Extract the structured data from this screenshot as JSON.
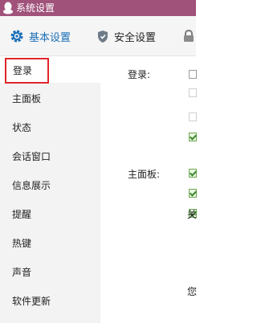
{
  "window": {
    "title": "系统设置"
  },
  "tabs": {
    "basic": "基本设置",
    "security": "安全设置"
  },
  "sidebar": {
    "items": [
      {
        "label": "登录",
        "active": true
      },
      {
        "label": "主面板"
      },
      {
        "label": "状态"
      },
      {
        "label": "会话窗口"
      },
      {
        "label": "信息展示"
      },
      {
        "label": "提醒"
      },
      {
        "label": "热键"
      },
      {
        "label": "声音"
      },
      {
        "label": "软件更新"
      }
    ]
  },
  "content": {
    "login_section": {
      "label": "登录:",
      "checkboxes": [
        "unchecked",
        "unchecked-faint",
        "unchecked-faint",
        "checked"
      ]
    },
    "panel_section": {
      "label": "主面板:",
      "checkboxes": [
        "checked",
        "checked",
        "checked"
      ]
    },
    "fragments": [
      "关",
      "您"
    ]
  },
  "colors": {
    "titlebar": "#a0527a",
    "accent": "#1a6fb8",
    "highlight": "#e0262c",
    "check": "#3a8a2a"
  }
}
